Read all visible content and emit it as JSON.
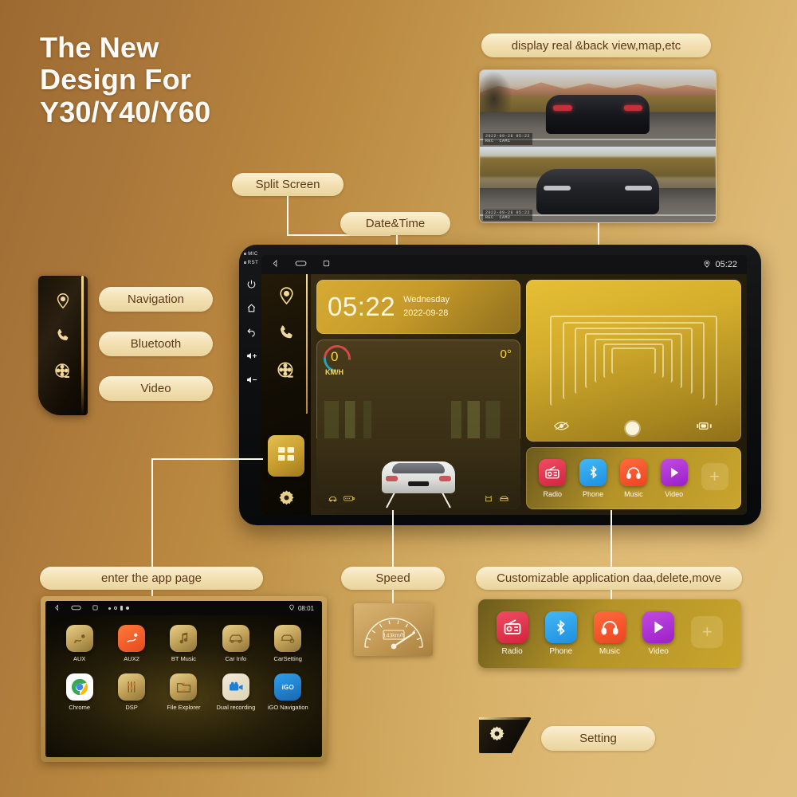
{
  "headline": {
    "line1": "The New",
    "line2": "Design For",
    "line3": "Y30/Y40/Y60"
  },
  "callouts": {
    "camera": "display real &back view,map,etc",
    "split_screen": "Split Screen",
    "date_time": "Date&Time",
    "navigation": "Navigation",
    "bluetooth": "Bluetooth",
    "video": "Video",
    "app_page": "enter the app page",
    "speed": "Speed",
    "customizable": "Customizable application daa,delete,move",
    "setting": "Setting"
  },
  "head_unit": {
    "hardware": {
      "mic_label": "MIC",
      "rst_label": "RST",
      "buttons": [
        "power-icon",
        "home-icon",
        "back-icon",
        "volume-up-icon",
        "volume-down-icon"
      ]
    },
    "status_bar": {
      "back": "back-icon",
      "home": "home-icon",
      "recents": "recents-icon",
      "location": "location-icon",
      "time": "05:22"
    },
    "side_rail": [
      {
        "name": "navigation",
        "icon": "location-pin-icon"
      },
      {
        "name": "phone",
        "icon": "phone-icon"
      },
      {
        "name": "video",
        "icon": "film-reel-icon"
      },
      {
        "name": "apps",
        "icon": "app-grid-icon",
        "active": true
      },
      {
        "name": "settings",
        "icon": "gear-icon"
      }
    ],
    "clock_widget": {
      "time": "05:22",
      "weekday": "Wednesday",
      "date": "2022-09-28"
    },
    "speed_widget": {
      "value": "0",
      "unit": "KM/H",
      "heading": "0°"
    },
    "dvr_widget": {
      "eye_icon": "eye-preview-icon",
      "shutter_icon": "shutter-icon",
      "camcorder_icon": "camcorder-icon"
    },
    "dock": [
      {
        "label": "Radio",
        "icon": "radio-icon",
        "color": "#e0304a"
      },
      {
        "label": "Phone",
        "icon": "bluetooth-icon",
        "color": "#26a0e8"
      },
      {
        "label": "Music",
        "icon": "headphones-icon",
        "color": "#f3542a"
      },
      {
        "label": "Video",
        "icon": "play-icon",
        "color": "#a927cd"
      },
      {
        "label": "",
        "icon": "plus-icon",
        "color": "#cbb37a"
      }
    ]
  },
  "app_page": {
    "status_time": "08:01",
    "rows": [
      [
        {
          "label": "AUX",
          "icon": "aux-cable-icon"
        },
        {
          "label": "AUX2",
          "icon": "aux2-cable-icon"
        },
        {
          "label": "BT Music",
          "icon": "music-note-icon"
        },
        {
          "label": "Car Info",
          "icon": "car-info-icon"
        },
        {
          "label": "CarSetting",
          "icon": "car-setting-icon"
        }
      ],
      [
        {
          "label": "Chrome",
          "icon": "chrome-icon"
        },
        {
          "label": "DSP",
          "icon": "equalizer-icon"
        },
        {
          "label": "File Explorer",
          "icon": "folder-icon"
        },
        {
          "label": "Dual recording",
          "icon": "camcorder-icon"
        },
        {
          "label": "iGO Navigation",
          "icon": "igo-icon"
        }
      ]
    ]
  },
  "speedometer": {
    "reading": "143km/h",
    "ticks": [
      "20",
      "40",
      "60",
      "80",
      "100",
      "120",
      "140",
      "160"
    ]
  },
  "colors": {
    "background_dark": "#9c6a31",
    "background_light": "#e0c083",
    "gold_accent": "#e5c054",
    "pill_bg": "#f4e2b6",
    "pill_text": "#5b3a1c",
    "screen_dark": "#111114"
  }
}
